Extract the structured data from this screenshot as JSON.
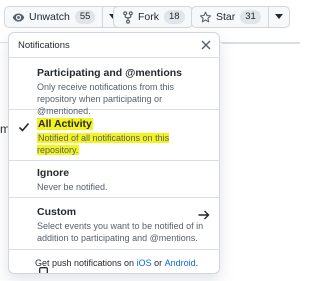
{
  "toolbar": {
    "watch": {
      "label": "Unwatch",
      "count": "55",
      "icon": "eye-icon"
    },
    "fork": {
      "label": "Fork",
      "count": "18",
      "icon": "repo-forked-icon"
    },
    "star": {
      "label": "Star",
      "count": "31",
      "icon": "star-icon"
    }
  },
  "background": {
    "partial_letter": "m"
  },
  "menu": {
    "title": "Notifications",
    "items": [
      {
        "title": "Participating and @mentions",
        "description": "Only receive notifications from this repository when participating or @mentioned.",
        "selected": false
      },
      {
        "title": "All Activity",
        "description": "Notified of all notifications on this repository.",
        "selected": true,
        "highlight_color": "#f3f320"
      },
      {
        "title": "Ignore",
        "description": "Never be notified.",
        "selected": false
      },
      {
        "title": "Custom",
        "description": "Select events you want to be notified of in addition to participating and @mentions.",
        "selected": false,
        "icon": "arrow-right-icon"
      }
    ],
    "push": {
      "prefix": "Get push notifications on ",
      "ios": "iOS",
      "conj": " or ",
      "android": "Android",
      "suffix": "."
    }
  },
  "colors": {
    "link": "#0969da",
    "highlight": "#f3f320",
    "border": "#d0d7de"
  }
}
